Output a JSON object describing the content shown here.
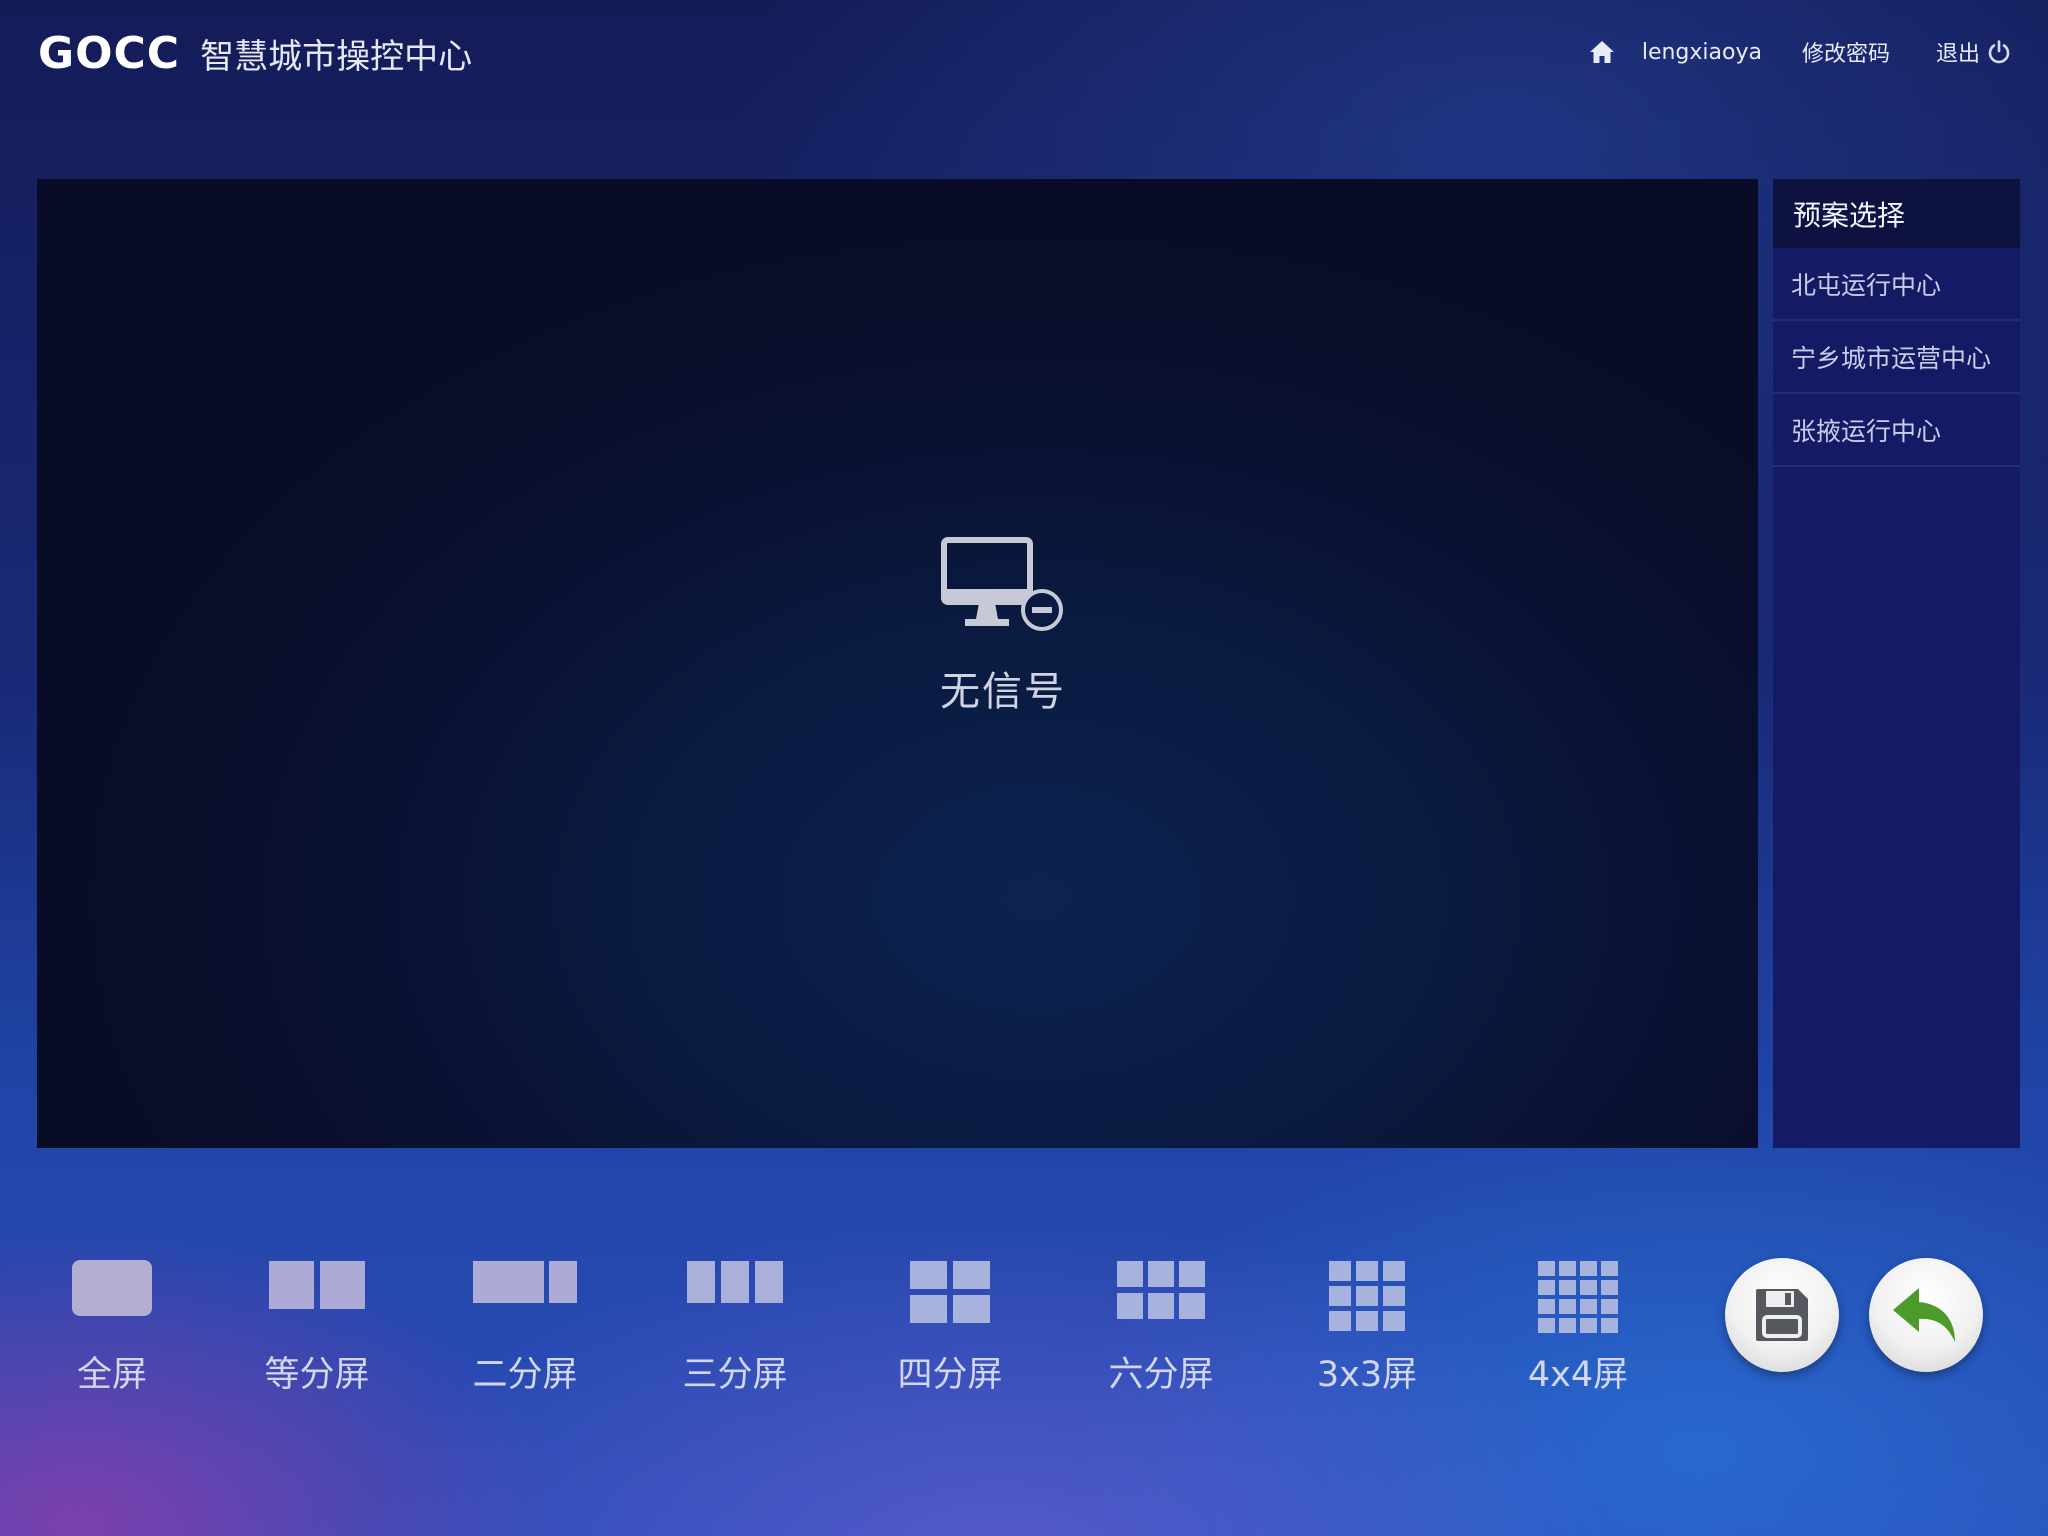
{
  "header": {
    "brand_code": "GOCC",
    "brand_title": "智慧城市操控中心",
    "nav": {
      "home_icon": "home-icon",
      "username": "lengxiaoya",
      "change_password": "修改密码",
      "logout": "退出",
      "logout_icon": "power-icon"
    }
  },
  "screen": {
    "status_icon": "monitor-disconnected-icon",
    "status_text": "无信号"
  },
  "plan_panel": {
    "title": "预案选择",
    "items": [
      {
        "label": "北屯运行中心"
      },
      {
        "label": "宁乡城市运营中心"
      },
      {
        "label": "张掖运行中心"
      }
    ]
  },
  "layout_toolbar": {
    "buttons": [
      {
        "label": "全屏",
        "icon": "fullscreen-layout-icon"
      },
      {
        "label": "等分屏",
        "icon": "equal-split-layout-icon"
      },
      {
        "label": "二分屏",
        "icon": "two-split-layout-icon"
      },
      {
        "label": "三分屏",
        "icon": "three-split-layout-icon"
      },
      {
        "label": "四分屏",
        "icon": "four-split-layout-icon"
      },
      {
        "label": "六分屏",
        "icon": "six-split-layout-icon"
      },
      {
        "label": "3x3屏",
        "icon": "grid-3x3-layout-icon"
      },
      {
        "label": "4x4屏",
        "icon": "grid-4x4-layout-icon"
      }
    ],
    "save_icon": "save-icon",
    "undo_icon": "undo-icon"
  },
  "colors": {
    "tile": "#aab0d8",
    "tile_light": "#b4aed3",
    "undo_green": "#4c9a2a",
    "save_gray": "#55585e"
  }
}
